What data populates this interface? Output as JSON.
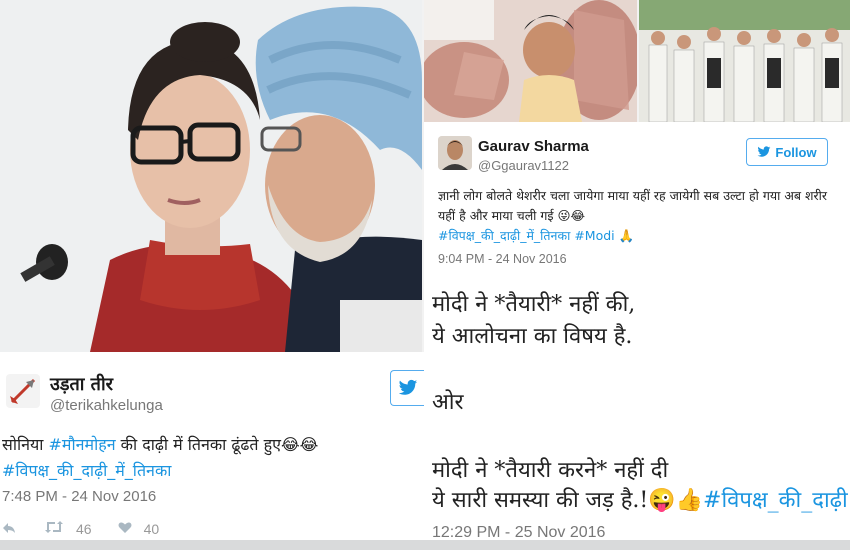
{
  "left_tweet": {
    "name": "उड़ता तीर",
    "handle": "@terikahkelunga",
    "text": "सोनिया ",
    "hashtag_inline": "#मौनमोहन",
    "text_rest": " की दाढ़ी में तिनका ढूंढते हुए😂😂",
    "hashtag": "#विपक्ष_की_दाढ़ी_में_तिनका",
    "timestamp": "7:48 PM - 24 Nov 2016",
    "retweets": "46",
    "likes": "40"
  },
  "right_tweet": {
    "name": "Gaurav Sharma",
    "handle": "@Ggaurav1122",
    "follow_label": "Follow",
    "text": "ज्ञानी लोग बोलते थेशरीर चला जायेगा माया यहीं रह जायेगी सब उल्टा हो गया अब शरीर यहीं है और माया चली गई 😜😂",
    "hashtag1": "#विपक्ष_की_दाढ़ी_में_तिनका",
    "hashtag2": "#Modi",
    "emoji_end": "🙏",
    "timestamp": "9:04 PM - 24 Nov 2016"
  },
  "text_card": {
    "line1": "मोदी ने *तैयारी* नहीं की,",
    "line2": "ये आलोचना का विषय है.",
    "line3": "ओर",
    "line4": "मोदी ने *तैयारी करने* नहीं दी",
    "line5": "ये सारी समस्या की जड़ है.!😜👍",
    "hashtag": "#विपक्ष_की_दाढ़ी",
    "timestamp": "12:29 PM - 25 Nov 2016"
  },
  "colors": {
    "link": "#1b95e0",
    "twitter_blue": "#55acee"
  },
  "icons": [
    "twitter-bird-icon",
    "retweet-icon",
    "heart-icon",
    "reply-icon",
    "arrow-avatar-icon"
  ]
}
